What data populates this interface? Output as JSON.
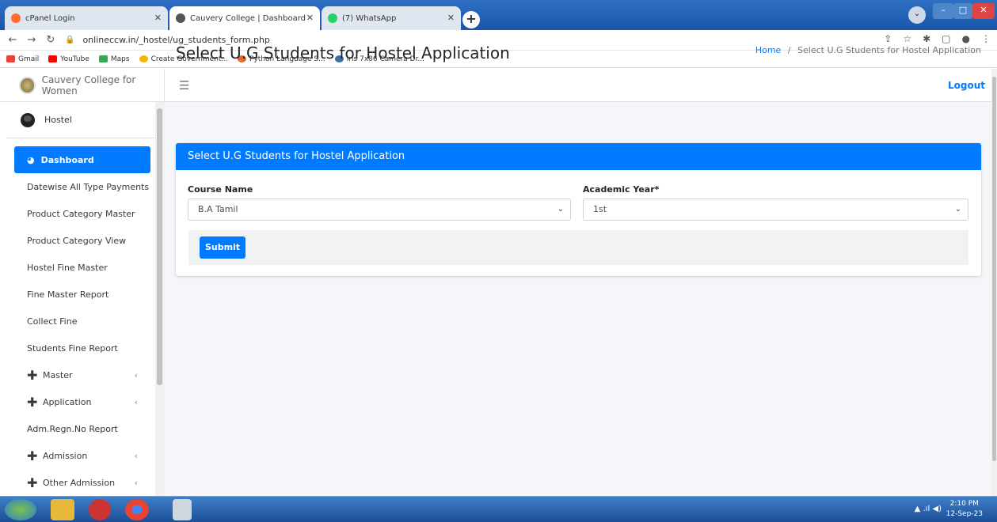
{
  "browser": {
    "tabs": [
      {
        "title": "cPanel Login",
        "active": false
      },
      {
        "title": "Cauvery College | Dashboard",
        "active": true
      },
      {
        "title": "(7) WhatsApp",
        "active": false
      }
    ],
    "url": "onlineccw.in/_hostel/ug_students_form.php",
    "bookmarks": [
      "Gmail",
      "YouTube",
      "Maps",
      "Create Government...",
      "Python Language S...",
      "Iris 7x86 Camera Dr..."
    ]
  },
  "app": {
    "brand": "Cauvery College for Women",
    "user": "Hostel",
    "logout": "Logout",
    "menu_icon": "hamburger-icon"
  },
  "sidebar": {
    "items": [
      {
        "label": "Dashboard",
        "active": true
      },
      {
        "label": "Datewise All Type Payments"
      },
      {
        "label": "Product Category Master"
      },
      {
        "label": "Product Category View"
      },
      {
        "label": "Hostel Fine Master"
      },
      {
        "label": "Fine Master Report"
      },
      {
        "label": "Collect Fine"
      },
      {
        "label": "Students Fine Report"
      },
      {
        "label": "Master",
        "expandable": true
      },
      {
        "label": "Application",
        "expandable": true
      },
      {
        "label": "Adm.Regn.No Report"
      },
      {
        "label": "Admission",
        "expandable": true
      },
      {
        "label": "Other Admission",
        "expandable": true
      }
    ]
  },
  "main": {
    "title": "Select U.G Students for Hostel Application",
    "breadcrumb": {
      "home": "Home",
      "separator": "/",
      "current": "Select U.G Students for Hostel Application"
    },
    "card": {
      "header": "Select U.G Students for Hostel Application",
      "course_label": "Course Name",
      "course_value": "B.A Tamil",
      "year_label": "Academic Year*",
      "year_value": "1st",
      "submit_label": "Submit"
    }
  },
  "taskbar": {
    "time": "2:10 PM",
    "date": "12-Sep-23"
  },
  "colors": {
    "primary": "#007bff",
    "taskbar": "#1c4e96",
    "tabstrip": "#1f5fb4"
  }
}
